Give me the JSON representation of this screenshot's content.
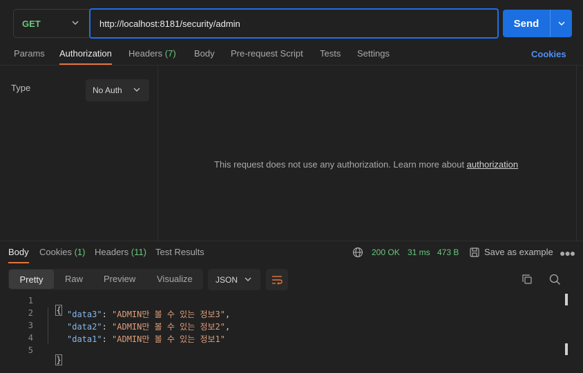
{
  "request": {
    "method": "GET",
    "url": "http://localhost:8181/security/admin",
    "send_label": "Send"
  },
  "request_tabs": [
    {
      "label": "Params"
    },
    {
      "label": "Authorization"
    },
    {
      "label": "Headers",
      "count": "(7)"
    },
    {
      "label": "Body"
    },
    {
      "label": "Pre-request Script"
    },
    {
      "label": "Tests"
    },
    {
      "label": "Settings"
    }
  ],
  "cookies_link": "Cookies",
  "auth": {
    "type_label": "Type",
    "type_value": "No Auth",
    "message": "This request does not use any authorization. Learn more about ",
    "link": "authorization"
  },
  "response_tabs": [
    {
      "label": "Body"
    },
    {
      "label": "Cookies",
      "count": "(1)"
    },
    {
      "label": "Headers",
      "count": "(11)"
    },
    {
      "label": "Test Results"
    }
  ],
  "response_meta": {
    "status": "200 OK",
    "time": "31 ms",
    "size": "473 B",
    "save_label": "Save as example"
  },
  "format_tabs": [
    "Pretty",
    "Raw",
    "Preview",
    "Visualize"
  ],
  "format_select": "JSON",
  "code": {
    "line_numbers": [
      "1",
      "2",
      "3",
      "4",
      "5"
    ],
    "open_brace": "{",
    "close_brace": "}",
    "entries": [
      {
        "key": "\"data3\"",
        "value": "\"ADMIN만 볼 수 있는 정보3\"",
        "trail": ","
      },
      {
        "key": "\"data2\"",
        "value": "\"ADMIN만 볼 수 있는 정보2\"",
        "trail": ","
      },
      {
        "key": "\"data1\"",
        "value": "\"ADMIN만 볼 수 있는 정보1\"",
        "trail": ""
      }
    ]
  },
  "colors": {
    "accent_blue": "#1b6fe0",
    "tab_underline": "#e8743b",
    "success_green": "#6bc77d"
  }
}
